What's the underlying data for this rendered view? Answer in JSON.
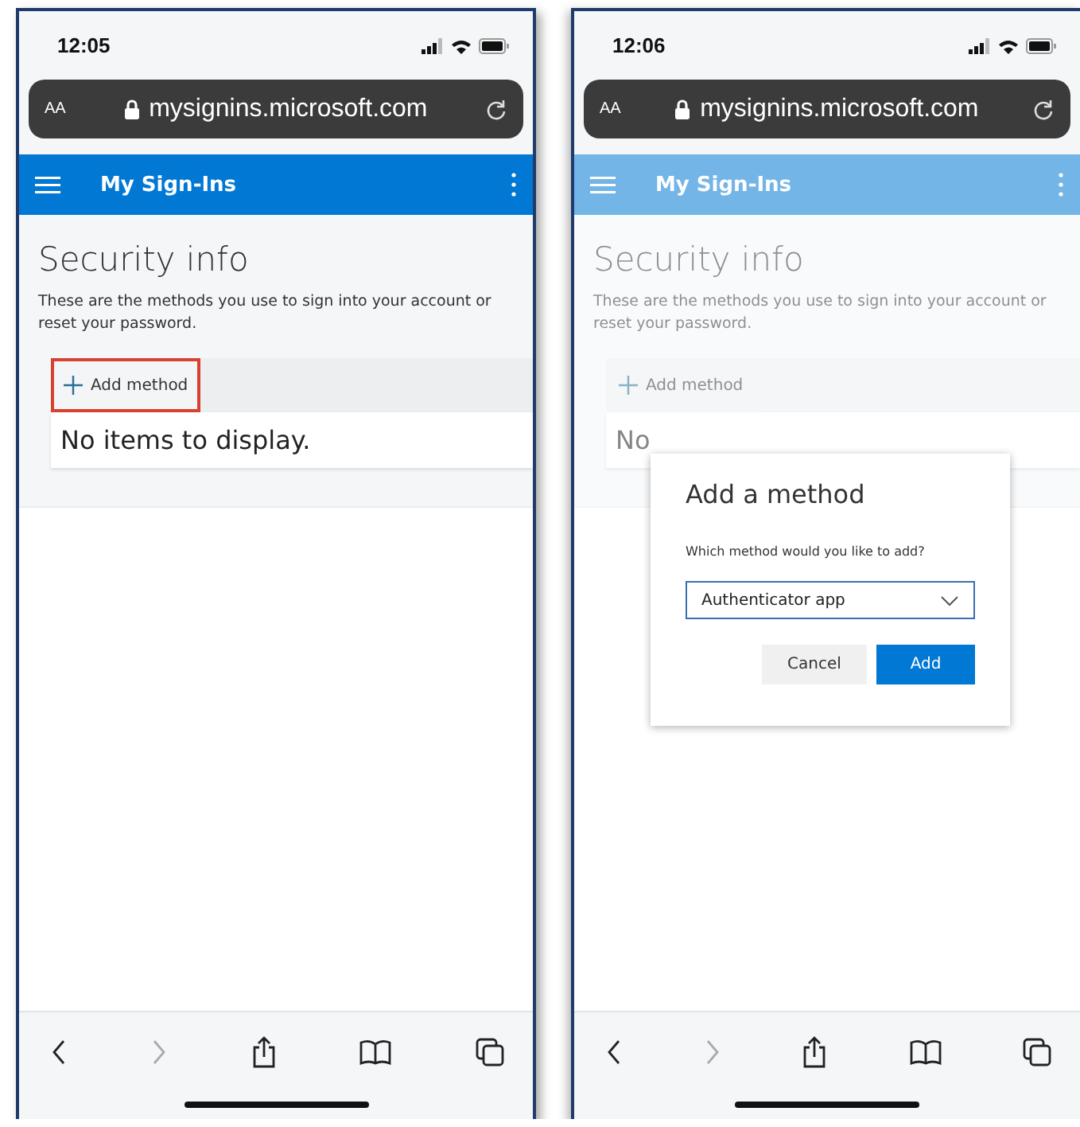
{
  "phones": [
    {
      "status_bar": {
        "time": "12:05"
      },
      "address_bar": {
        "text_size": "AA",
        "url": "mysignins.microsoft.com"
      },
      "header": {
        "title": "My Sign-Ins"
      },
      "page": {
        "title": "Security info",
        "description": "These are the methods you use to sign into your account or reset your password.",
        "add_method": {
          "label": "Add method",
          "highlighted": true
        },
        "empty_message": "No items to display."
      },
      "dimmed": false
    },
    {
      "status_bar": {
        "time": "12:06"
      },
      "address_bar": {
        "text_size": "AA",
        "url": "mysignins.microsoft.com"
      },
      "header": {
        "title": "My Sign-Ins"
      },
      "page": {
        "title": "Security info",
        "description": "These are the methods you use to sign into your account or reset your password.",
        "add_method": {
          "label": "Add method",
          "highlighted": false
        },
        "empty_message": "No"
      },
      "dimmed": true,
      "dialog": {
        "title": "Add a method",
        "prompt": "Which method would you like to add?",
        "select_value": "Authenticator app",
        "buttons": [
          {
            "label": "Cancel",
            "kind": "secondary"
          },
          {
            "label": "Add",
            "kind": "primary"
          }
        ]
      }
    }
  ]
}
